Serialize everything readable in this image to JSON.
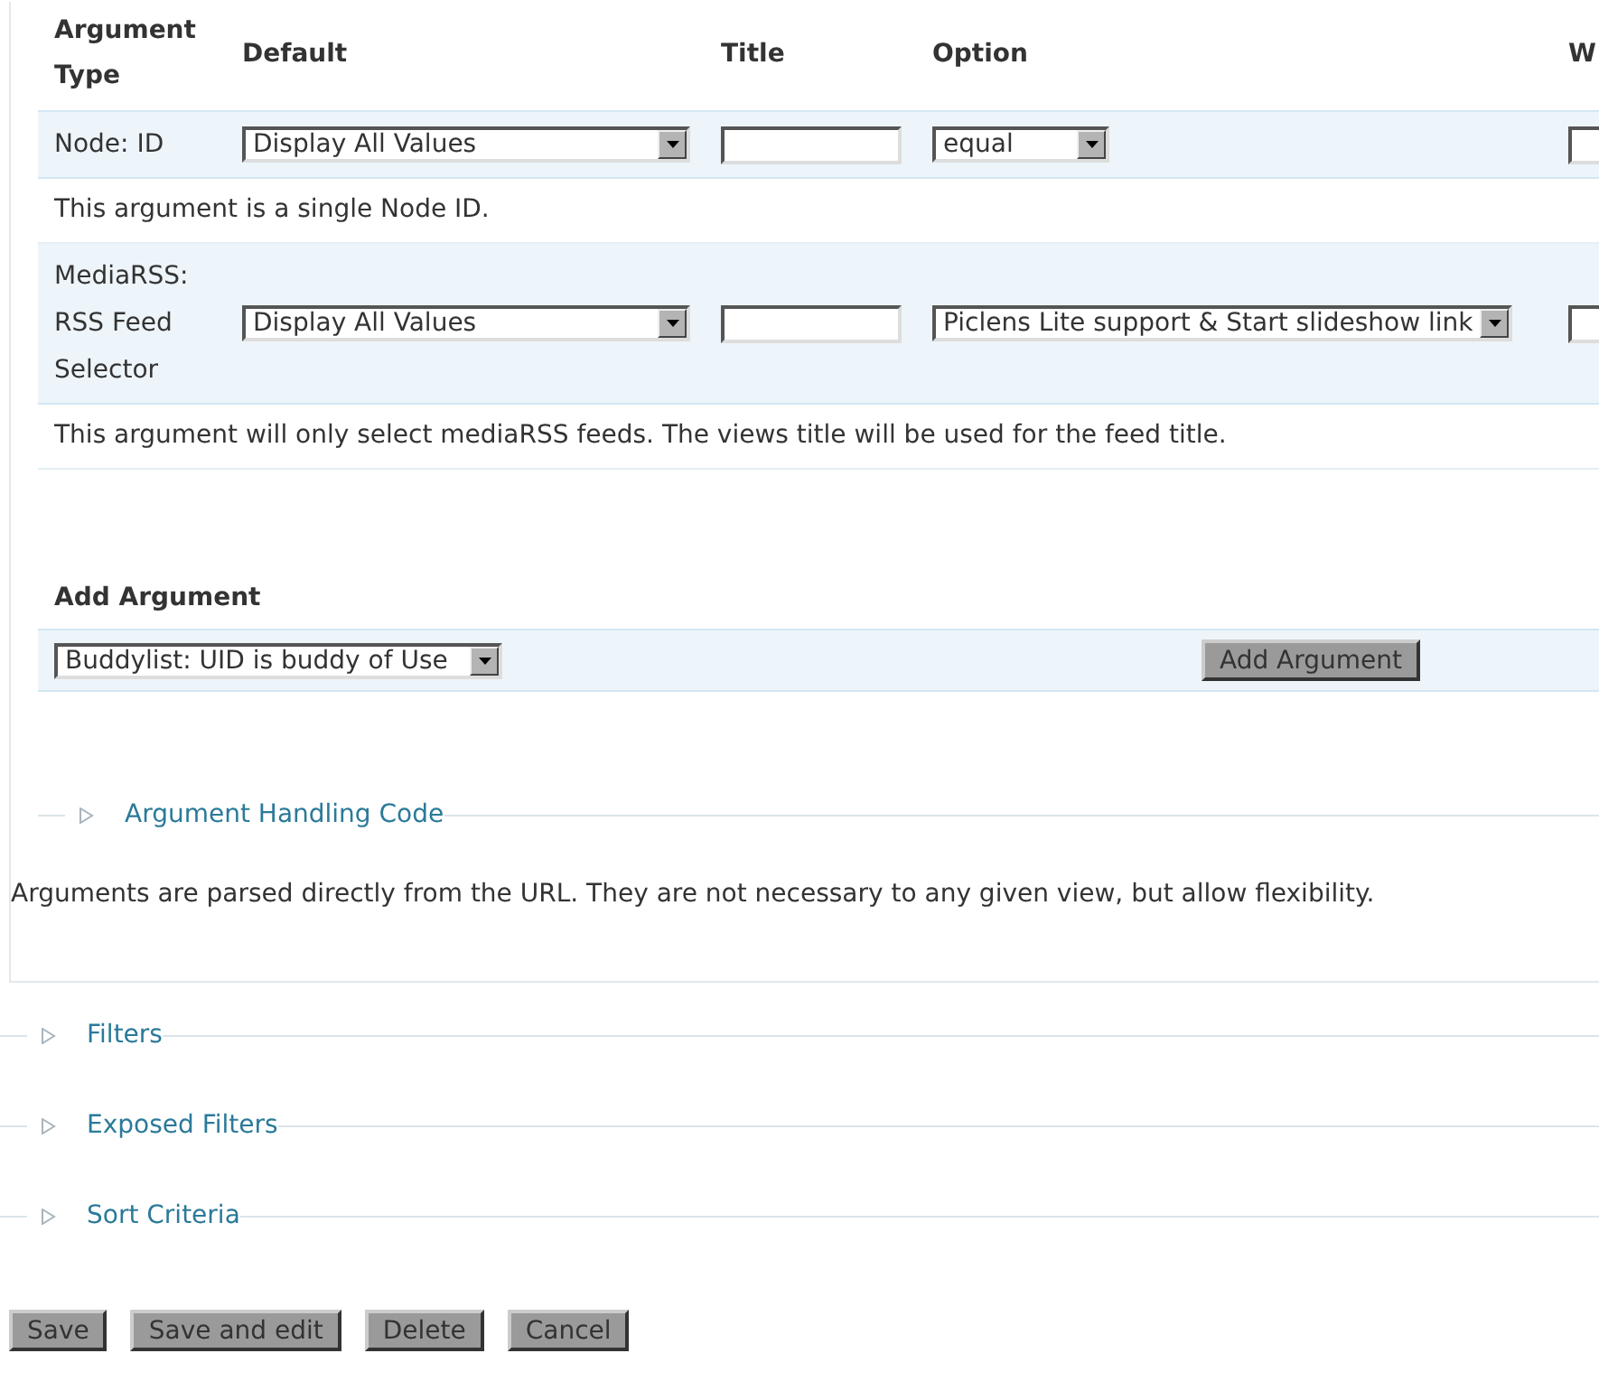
{
  "arguments_table": {
    "columns": [
      "Argument Type",
      "Default",
      "Title",
      "Option",
      "W"
    ],
    "rows": [
      {
        "type": "Node: ID",
        "default": "Display All Values",
        "option": "equal",
        "description": "This argument is a single Node ID."
      },
      {
        "type": "MediaRSS: RSS Feed Selector",
        "default": "Display All Values",
        "option": "Piclens Lite support & Start slideshow link",
        "description": "This argument will only select mediaRSS feeds. The views title will be used for the feed title."
      }
    ]
  },
  "add_argument": {
    "heading": "Add Argument",
    "select": "Buddylist: UID is buddy of Use",
    "button": "Add Argument"
  },
  "handling_code": {
    "label": "Argument Handling Code",
    "expanded": false
  },
  "help_text": "Arguments are parsed directly from the URL. They are not necessary to any given view, but allow flexibility.",
  "sections": [
    {
      "label": "Filters",
      "expanded": false
    },
    {
      "label": "Exposed Filters",
      "expanded": false
    },
    {
      "label": "Sort Criteria",
      "expanded": false
    }
  ],
  "buttons": [
    "Save",
    "Save and edit",
    "Delete",
    "Cancel"
  ]
}
